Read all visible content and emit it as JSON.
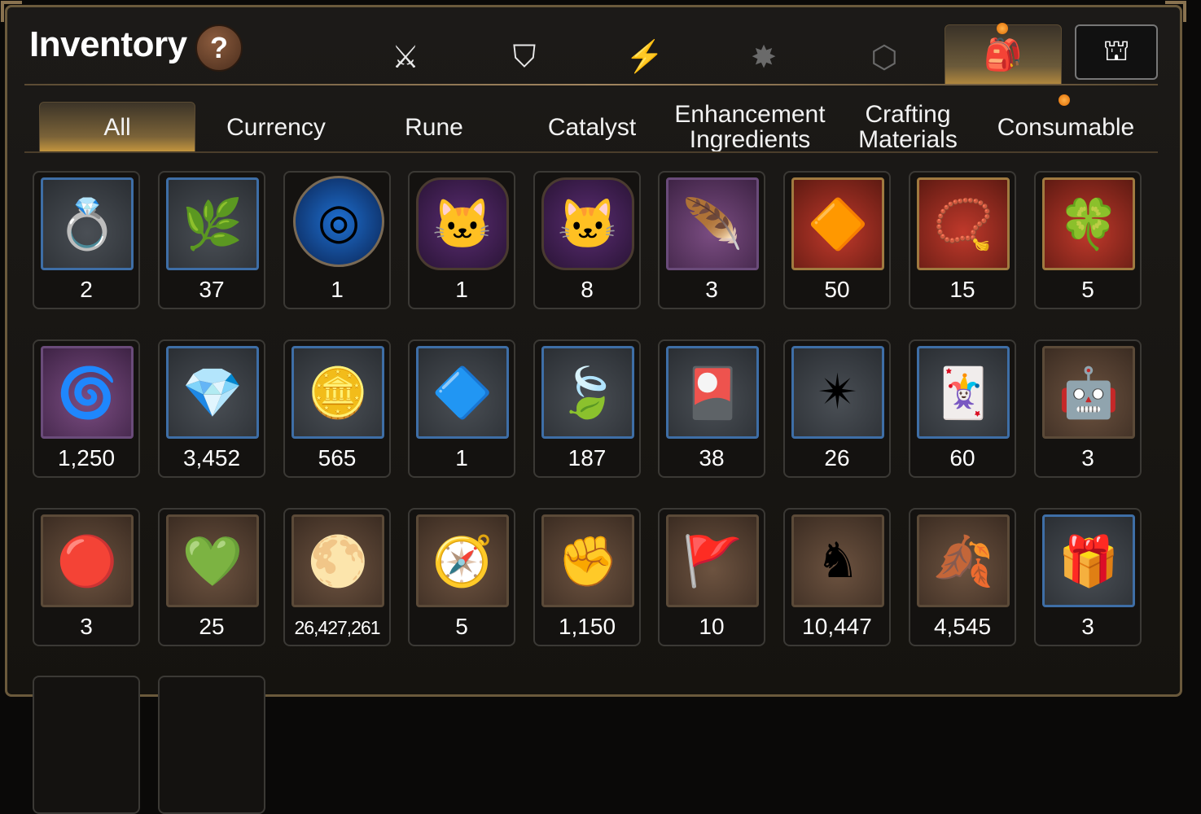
{
  "header": {
    "title": "Inventory",
    "help_label": "?"
  },
  "category_tabs": [
    {
      "icon": "sword-shield-icon",
      "glyph": "⚔"
    },
    {
      "icon": "broken-shield-icon",
      "glyph": "⛉"
    },
    {
      "icon": "lightning-icon",
      "glyph": "⚡"
    },
    {
      "icon": "rune-burst-icon",
      "glyph": "✸"
    },
    {
      "icon": "cube-icon",
      "glyph": "⬡"
    },
    {
      "icon": "backpack-icon",
      "glyph": "🎒"
    },
    {
      "icon": "guild-house-icon",
      "glyph": "⛫"
    }
  ],
  "subtabs": [
    {
      "label": "All"
    },
    {
      "label": "Currency"
    },
    {
      "label": "Rune"
    },
    {
      "label": "Catalyst"
    },
    {
      "label": "Enhancement Ingredients"
    },
    {
      "label": "Crafting Materials"
    },
    {
      "label": "Consumable"
    }
  ],
  "items": [
    {
      "icon": "ring-icon",
      "count": "2",
      "frame": "blue",
      "glyph": "💍"
    },
    {
      "icon": "ginseng-root-icon",
      "count": "37",
      "frame": "blue",
      "glyph": "🌿"
    },
    {
      "icon": "blue-orb-icon",
      "count": "1",
      "frame": "circle",
      "glyph": "◎"
    },
    {
      "icon": "pet-food-bag-icon",
      "count": "1",
      "frame": "hex",
      "glyph": "🐱"
    },
    {
      "icon": "pet-food-bag-icon",
      "count": "8",
      "frame": "hex",
      "glyph": "🐱"
    },
    {
      "icon": "feather-wand-icon",
      "count": "3",
      "frame": "purple",
      "glyph": "🪶"
    },
    {
      "icon": "amber-crystal-icon",
      "count": "50",
      "frame": "red",
      "glyph": "🔶"
    },
    {
      "icon": "pendant-icon",
      "count": "15",
      "frame": "red",
      "glyph": "📿"
    },
    {
      "icon": "clover-charm-icon",
      "count": "5",
      "frame": "red",
      "glyph": "🍀"
    },
    {
      "icon": "flame-ring-icon",
      "count": "1,250",
      "frame": "purple",
      "glyph": "🌀"
    },
    {
      "icon": "blue-crystal-icon",
      "count": "3,452",
      "frame": "blue",
      "glyph": "💎"
    },
    {
      "icon": "silver-coin-icon",
      "count": "565",
      "frame": "blue",
      "glyph": "🪙"
    },
    {
      "icon": "teal-crystal-icon",
      "count": "1",
      "frame": "blue",
      "glyph": "🔷"
    },
    {
      "icon": "green-leaf-icon",
      "count": "187",
      "frame": "blue",
      "glyph": "🍃"
    },
    {
      "icon": "card-ticket-icon",
      "count": "38",
      "frame": "blue",
      "glyph": "🎴"
    },
    {
      "icon": "star-amulet-icon",
      "count": "26",
      "frame": "blue",
      "glyph": "✴"
    },
    {
      "icon": "outfit-card-icon",
      "count": "60",
      "frame": "blue",
      "glyph": "🃏"
    },
    {
      "icon": "robot-pod-icon",
      "count": "3",
      "frame": "brown",
      "glyph": "🤖"
    },
    {
      "icon": "red-badge-icon",
      "count": "3",
      "frame": "brown",
      "glyph": "🔴"
    },
    {
      "icon": "green-heart-icon",
      "count": "25",
      "frame": "brown",
      "glyph": "💚"
    },
    {
      "icon": "gold-coin-icon",
      "count": "26,427,261",
      "frame": "brown",
      "glyph": "🌕",
      "small": true
    },
    {
      "icon": "stone-compass-icon",
      "count": "5",
      "frame": "brown",
      "glyph": "🧭"
    },
    {
      "icon": "fist-emblem-icon",
      "count": "1,150",
      "frame": "brown",
      "glyph": "✊"
    },
    {
      "icon": "red-banner-icon",
      "count": "10",
      "frame": "brown",
      "glyph": "🚩"
    },
    {
      "icon": "knight-chess-icon",
      "count": "10,447",
      "frame": "brown",
      "glyph": "♞"
    },
    {
      "icon": "red-leaves-icon",
      "count": "4,545",
      "frame": "brown",
      "glyph": "🍂"
    },
    {
      "icon": "jewel-box-icon",
      "count": "3",
      "frame": "blue",
      "glyph": "🎁"
    }
  ]
}
